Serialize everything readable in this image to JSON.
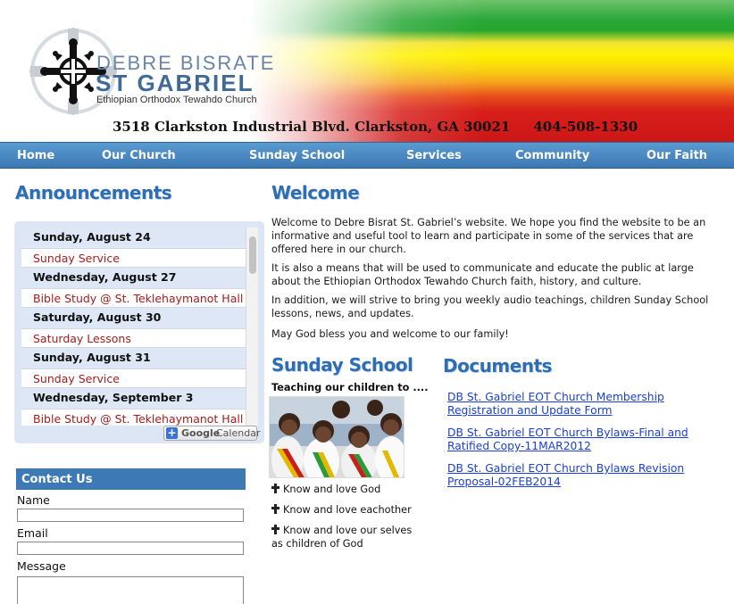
{
  "header": {
    "brand_line1": "DEBRE BISRATE",
    "brand_line2": "ST GABRIEL",
    "brand_line3": "Ethiopian Orthodox Tewahdo Church",
    "address": "3518 Clarkston Industrial Blvd.  Clarkston, GA 30021",
    "phone": "404-508-1330",
    "logo_icon": "ethiopian-cross-icon"
  },
  "nav": {
    "items": [
      "Home",
      "Our Church",
      "Sunday School",
      "Services",
      "Community",
      "Our Faith"
    ]
  },
  "announcements": {
    "heading": "Announcements",
    "rows": [
      {
        "kind": "date",
        "text": "Sunday, August 24"
      },
      {
        "kind": "event",
        "text": "Sunday Service"
      },
      {
        "kind": "date",
        "text": "Wednesday, August 27"
      },
      {
        "kind": "event",
        "text": "Bible Study @ St. Teklehaymanot Hall"
      },
      {
        "kind": "date",
        "text": "Saturday, August 30"
      },
      {
        "kind": "event",
        "text": "Saturday Lessons"
      },
      {
        "kind": "date",
        "text": "Sunday, August 31"
      },
      {
        "kind": "event",
        "text": "Sunday Service"
      },
      {
        "kind": "date",
        "text": "Wednesday, September 3"
      },
      {
        "kind": "event",
        "text": "Bible Study @ St. Teklehaymanot Hall"
      }
    ],
    "gcal_g": "Google",
    "gcal_cal": "Calendar"
  },
  "contact": {
    "heading": "Contact Us",
    "name_label": "Name",
    "email_label": "Email",
    "message_label": "Message"
  },
  "welcome": {
    "heading": "Welcome",
    "p1": "Welcome to Debre Bisrat St. Gabriel’s website. We hope you find the website to be an informative and useful tool to learn and participate in some of the services that are offered here in our church.",
    "p2": "It is also a means that will be used to communicate and educate the public at large about the Ethiopian Orthodox Tewahdo Church faith, history, and culture.",
    "p3": "In addition, we will strive to bring you weekly audio teachings, children Sunday School lessons, news, and updates.",
    "p4": "May God bless you and welcome to our family!"
  },
  "sunday_school": {
    "heading": "Sunday School",
    "tagline": "Teaching our children to ....",
    "items": [
      "Know and love God",
      "Know and love eachother",
      "Know and love our selves"
    ],
    "item3_cont": "as children of God"
  },
  "documents": {
    "heading": "Documents",
    "links": [
      "DB St. Gabriel EOT Church Membership Registration and Update Form",
      "DB St. Gabriel EOT Church Bylaws-Final and Ratified Copy-11MAR2012",
      "DB St. Gabriel EOT Church Bylaws Revision Proposal-02FEB2014"
    ]
  },
  "colors": {
    "nav": "#3d78b3",
    "heading": "#2f6db3",
    "event_text": "#a51c1c",
    "link": "#1a3fd4"
  }
}
